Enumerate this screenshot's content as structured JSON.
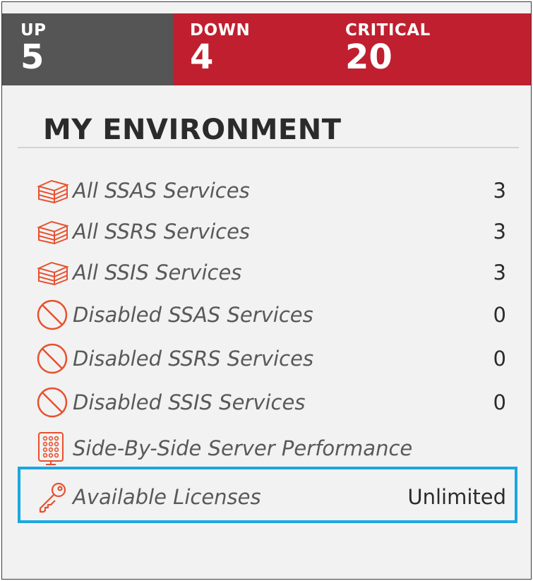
{
  "status": {
    "up": {
      "label": "UP",
      "count": "5"
    },
    "down": {
      "label": "DOWN",
      "count": "4"
    },
    "critical": {
      "label": "CRITICAL",
      "count": "20"
    }
  },
  "environment": {
    "title": "MY ENVIRONMENT",
    "items": [
      {
        "label": "All SSAS Services",
        "count": "3",
        "icon": "server-stack-icon"
      },
      {
        "label": "All SSRS Services",
        "count": "3",
        "icon": "server-stack-icon"
      },
      {
        "label": "All SSIS Services",
        "count": "3",
        "icon": "server-stack-icon"
      },
      {
        "label": "Disabled SSAS Services",
        "count": "0",
        "icon": "disabled-icon"
      },
      {
        "label": "Disabled SSRS Services",
        "count": "0",
        "icon": "disabled-icon"
      },
      {
        "label": "Disabled SSIS Services",
        "count": "0",
        "icon": "disabled-icon"
      },
      {
        "label": "Side-By-Side Server Performance",
        "count": "",
        "icon": "server-grid-icon"
      },
      {
        "label": "Available Licenses",
        "count": "Unlimited",
        "icon": "key-icon"
      }
    ]
  },
  "colors": {
    "up_bg": "#555555",
    "down_bg": "#c01f2f",
    "icon_accent": "#e8502e",
    "highlight": "#1aa8e0"
  }
}
